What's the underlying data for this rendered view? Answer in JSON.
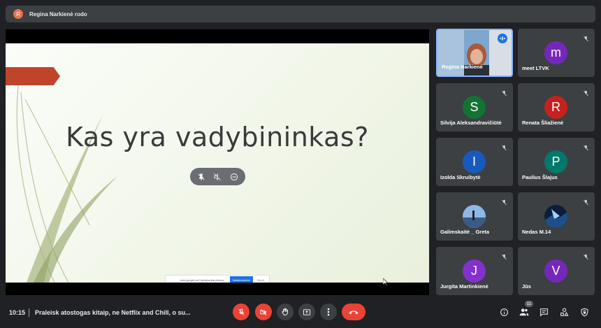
{
  "header": {
    "avatar_letter": "R",
    "presenter_text": "Regina Narkienė rodo"
  },
  "slide": {
    "title": "Kas yra vadybininkas?"
  },
  "notification": {
    "text": "„meet.google.com“ bendrina jūsų ekraną.",
    "button": "Nebebendrinti",
    "hide": "Slėpti"
  },
  "participants": [
    {
      "name": "Regina Narkienė",
      "letter": "",
      "color": "",
      "video": true
    },
    {
      "name": "meet LTVK",
      "letter": "m",
      "color": "#7627bb"
    },
    {
      "name": "Silvija Aleksandravičiūtė",
      "letter": "S",
      "color": "#137333"
    },
    {
      "name": "Renata Šliažienė",
      "letter": "R",
      "color": "#c5221f"
    },
    {
      "name": "Izolda Skruibytė",
      "letter": "I",
      "color": "#185abc"
    },
    {
      "name": "Paulius Šlajus",
      "letter": "P",
      "color": "#00796b"
    },
    {
      "name": "Galimskaitė _ Greta",
      "letter": "",
      "color": "",
      "photo": true
    },
    {
      "name": "Nedas M.14",
      "letter": "",
      "color": "",
      "photo": true
    },
    {
      "name": "Jurgita Martinkienė",
      "letter": "J",
      "color": "#8430ce"
    },
    {
      "name": "Jūs",
      "letter": "V",
      "color": "#7627bb"
    }
  ],
  "bottombar": {
    "time": "10:15",
    "meeting_title": "Praleisk atostogas kitaip, ne Netflix and Chill, o su...",
    "participant_count": "11"
  },
  "colors": {
    "background": "#202124",
    "tile": "#3c4043",
    "danger": "#ea4335",
    "ribbon": "#c0442a"
  }
}
